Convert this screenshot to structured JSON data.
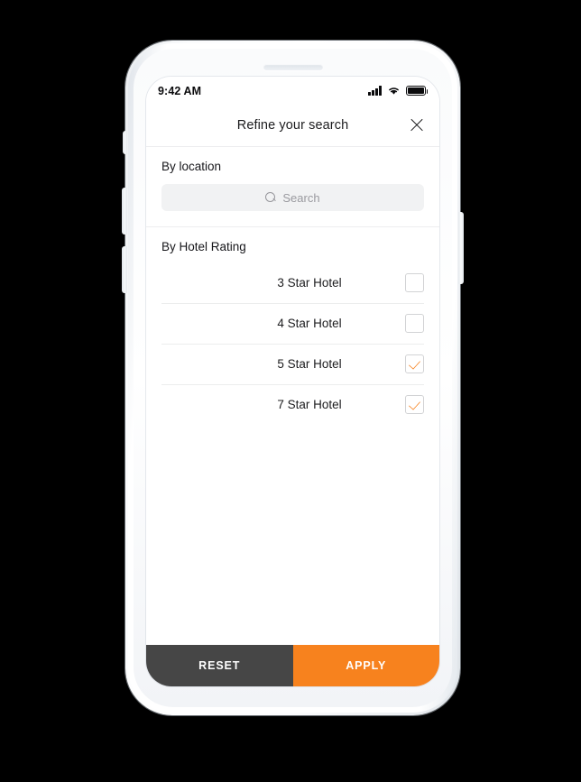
{
  "status_bar": {
    "time": "9:42 AM",
    "signal_icon": "signal-bars-icon",
    "wifi_icon": "wifi-icon",
    "battery_icon": "battery-full-icon"
  },
  "header": {
    "title": "Refine your search",
    "close_icon": "close-icon"
  },
  "location_section": {
    "label": "By location",
    "search": {
      "placeholder": "Search",
      "value": "",
      "icon": "search-icon"
    }
  },
  "rating_section": {
    "label": "By Hotel Rating",
    "options": [
      {
        "label": "3 Star Hotel",
        "checked": false
      },
      {
        "label": "4 Star Hotel",
        "checked": false
      },
      {
        "label": "5 Star Hotel",
        "checked": true
      },
      {
        "label": "7 Star Hotel",
        "checked": true
      }
    ]
  },
  "actions": {
    "reset_label": "RESET",
    "apply_label": "APPLY"
  },
  "colors": {
    "accent_orange": "#f7821e",
    "reset_gray": "#464646",
    "text_primary": "#1c1c1e",
    "placeholder_gray": "#9a9a9f",
    "field_bg": "#f1f2f3",
    "divider": "#eceded"
  }
}
